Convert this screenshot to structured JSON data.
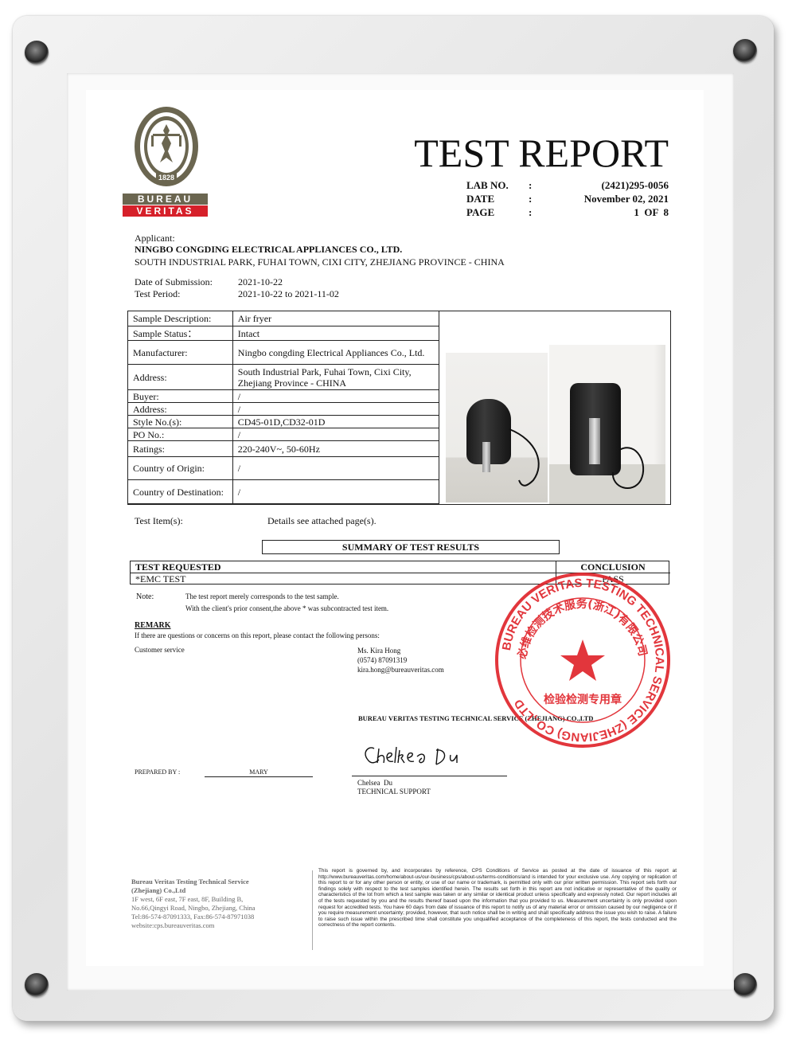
{
  "logo": {
    "ring_text": "BUREAU VERITAS",
    "year": "1828",
    "line1": "BUREAU",
    "line2": "VERITAS",
    "red": "#d6202a",
    "olive": "#6b6650"
  },
  "header": {
    "title": "TEST REPORT",
    "lab_no_label": "LAB NO.",
    "lab_no": "(2421)295-0056",
    "date_label": "DATE",
    "date": "November 02, 2021",
    "page_label": "PAGE",
    "page": "1  OF  8",
    "colon": ":"
  },
  "applicant": {
    "label": "Applicant:",
    "name": "NINGBO CONGDING ELECTRICAL APPLIANCES CO., LTD.",
    "address": "SOUTH INDUSTRIAL PARK, FUHAI TOWN, CIXI CITY, ZHEJIANG PROVINCE - CHINA"
  },
  "dates": {
    "submission_label": "Date of Submission:",
    "submission": "2021-10-22",
    "period_label": "Test Period:",
    "period": "2021-10-22 to 2021-11-02"
  },
  "sample_table": {
    "rows": [
      {
        "label": "Sample Description:",
        "value": "Air fryer"
      },
      {
        "label": "Sample Status：",
        "value": "Intact"
      },
      {
        "label": "Manufacturer:",
        "value": "Ningbo congding Electrical Appliances Co., Ltd."
      },
      {
        "label": "Address:",
        "value": "South Industrial Park, Fuhai Town, Cixi City, Zhejiang Province - CHINA"
      },
      {
        "label": "Buyer:",
        "value": "/"
      },
      {
        "label": "Address:",
        "value": "/"
      },
      {
        "label": "Style No.(s):",
        "value": "CD45-01D,CD32-01D"
      },
      {
        "label": "PO No.:",
        "value": "/"
      },
      {
        "label": "Ratings:",
        "value": "220-240V~, 50-60Hz"
      },
      {
        "label": "Country of Origin:",
        "value": "/"
      },
      {
        "label": "Country of Destination:",
        "value": "/"
      }
    ]
  },
  "test_items": {
    "label": "Test Item(s):",
    "value": "Details see attached page(s)."
  },
  "summary": {
    "title": "SUMMARY OF TEST RESULTS",
    "col_requested": "TEST REQUESTED",
    "col_conclusion": "CONCLUSION",
    "row_test": "*EMC TEST",
    "row_result": "PASS"
  },
  "note": {
    "label": "Note:",
    "line1": "The test report merely corresponds to the test sample.",
    "line2": "With the client's prior consent,the above * was subcontracted test item."
  },
  "remark": {
    "title": "REMARK",
    "text": "If there are questions or concerns on this report, please contact the following persons:",
    "service_label": "Customer service",
    "contact_name": "Ms. Kira Hong",
    "contact_phone": "(0574) 87091319",
    "contact_email": "kira.hong@bureauveritas.com"
  },
  "company_line": "BUREAU VERITAS TESTING TECHNICAL SERVICE (ZHEJIANG) CO.,LTD",
  "signature": {
    "prepared_label": "PREPARED BY :",
    "prepared_name": "MARY",
    "signer_name": "Chelsea  Du",
    "signer_title": "TECHNICAL SUPPORT"
  },
  "seal": {
    "ring_text": "BUREAU VERITAS TESTING TECHNICAL SERVICE (ZHEJIANG) CO.,LTD",
    "cn_arc": "必维检测技术服务(浙江)有限公司",
    "cn_bottom": "检验检测专用章",
    "color": "#e0252c"
  },
  "footer": {
    "company1": "Bureau Veritas Testing Technical Service",
    "company2": "(Zhejiang) Co.,Ltd",
    "addr1": "1F west, 6F east, 7F east, 8F, Building B,",
    "addr2": "No.66,Qingyi Road, Ningbo, Zhejiang, China",
    "tel": "Tel:86-574-87091333,  Fax:86-574-87971038",
    "web": "website:cps.bureauveritas.com",
    "disclaimer": "This report is governed by, and incorporates by reference, CPS Conditions of Service as posted at the date of issuance of this report at http://www.bureauveritas.com/home/about-us/our-business/cps/about-us/terms-conditions/and is intended for your exclusive use. Any copying or replication of this report to or for any other person or entity, or use of our name or trademark, is permitted only with our prior written permission. This report sets forth our findings solely with respect to the test samples identified herein. The results set forth in this report are not indicative or representative of the quality or characteristics of the lot from which a test sample was taken or any similar or identical product unless specifically and expressly noted. Our report includes all of the tests requested by you and the results thereof based upon the information that you provided to us. Measurement uncertainty is only provided upon request for accredited tests. You have 60 days from date of issuance of this report to notify us of any material error or omission caused by our negligence or if you require measurement uncertainty; provided, however, that such notice shall be in writing and shall specifically address the issue you wish to raise. A failure to raise such issue within the prescribed time shall constitute you unqualified acceptance of the completeness of this report, the tests conducted and the correctness of the report contents."
  }
}
